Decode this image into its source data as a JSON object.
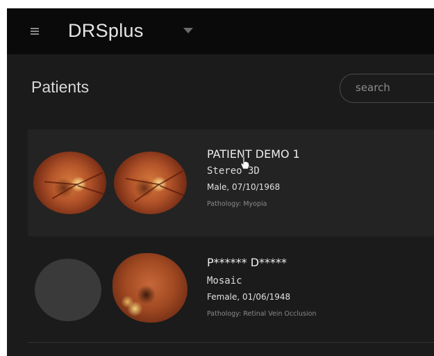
{
  "header": {
    "app_title": "DRSplus"
  },
  "page": {
    "title": "Patients"
  },
  "search": {
    "placeholder": "search"
  },
  "patients": [
    {
      "name": "PATIENT DEMO 1",
      "type": "Stereo 3D",
      "demographics": "Male, 07/10/1968",
      "pathology": "Pathology: Myopia"
    },
    {
      "name": "P****** D*****",
      "type": "Mosaic",
      "demographics": "Female, 01/06/1948",
      "pathology": "Pathology: Retinal Vein Occlusion"
    }
  ],
  "colors": {
    "app_background": "#1b1b1b",
    "topbar_background": "#0a0a0a",
    "selected_card": "#232323",
    "text_primary": "#ececec",
    "text_secondary": "#8a8a8a"
  },
  "icons": {
    "menu": "hamburger-menu-icon",
    "dropdown": "caret-down-icon",
    "pointer": "hand-cursor-icon"
  }
}
